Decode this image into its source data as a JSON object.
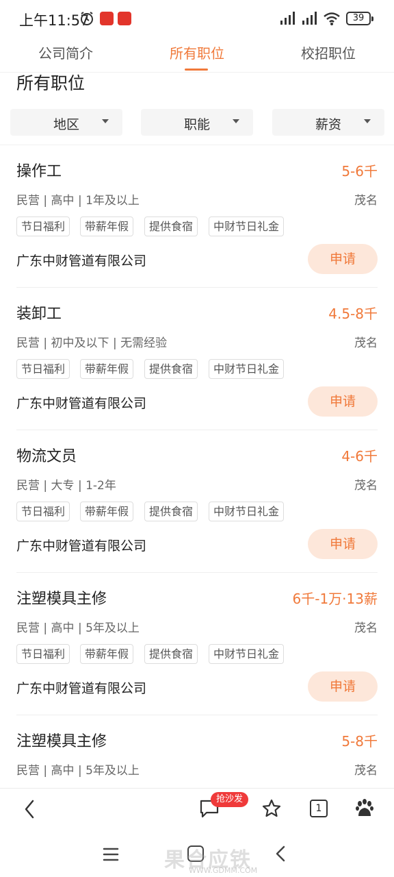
{
  "status_bar": {
    "time": "上午11:57",
    "battery": "39",
    "icons": [
      "alarm-icon",
      "app-badge-icon",
      "app-badge-icon",
      "signal-hd-icon",
      "signal-hd-icon",
      "wifi-icon",
      "battery-icon"
    ]
  },
  "tabs": [
    {
      "label": "公司简介",
      "active": false
    },
    {
      "label": "所有职位",
      "active": true
    },
    {
      "label": "校招职位",
      "active": false
    }
  ],
  "section_title": "所有职位",
  "filters": [
    {
      "label": "地区"
    },
    {
      "label": "职能"
    },
    {
      "label": "薪资"
    }
  ],
  "jobs": [
    {
      "title": "操作工",
      "salary": "5-6千",
      "meta": "民营 | 高中 | 1年及以上",
      "city": "茂名",
      "tags": [
        "节日福利",
        "带薪年假",
        "提供食宿",
        "中财节日礼金"
      ],
      "company": "广东中财管道有限公司",
      "apply_label": "申请"
    },
    {
      "title": "装卸工",
      "salary": "4.5-8千",
      "meta": "民营 | 初中及以下 | 无需经验",
      "city": "茂名",
      "tags": [
        "节日福利",
        "带薪年假",
        "提供食宿",
        "中财节日礼金"
      ],
      "company": "广东中财管道有限公司",
      "apply_label": "申请"
    },
    {
      "title": "物流文员",
      "salary": "4-6千",
      "meta": "民营 | 大专 | 1-2年",
      "city": "茂名",
      "tags": [
        "节日福利",
        "带薪年假",
        "提供食宿",
        "中财节日礼金"
      ],
      "company": "广东中财管道有限公司",
      "apply_label": "申请"
    },
    {
      "title": "注塑模具主修",
      "salary": "6千-1万·13薪",
      "meta": "民营 | 高中 | 5年及以上",
      "city": "茂名",
      "tags": [
        "节日福利",
        "带薪年假",
        "提供食宿",
        "中财节日礼金"
      ],
      "company": "广东中财管道有限公司",
      "apply_label": "申请"
    },
    {
      "title": "注塑模具主修",
      "salary": "5-8千",
      "meta": "民营 | 高中 | 5年及以上",
      "city": "茂名"
    }
  ],
  "bottom_bar": {
    "chat_badge": "抢沙发",
    "tab_count": "1"
  },
  "watermark": {
    "text": "果合应铁",
    "url": "WWW.GDMM.COM"
  },
  "colors": {
    "accent": "#f0793a",
    "apply_bg": "#fde7da",
    "badge": "#ef3a3a"
  }
}
